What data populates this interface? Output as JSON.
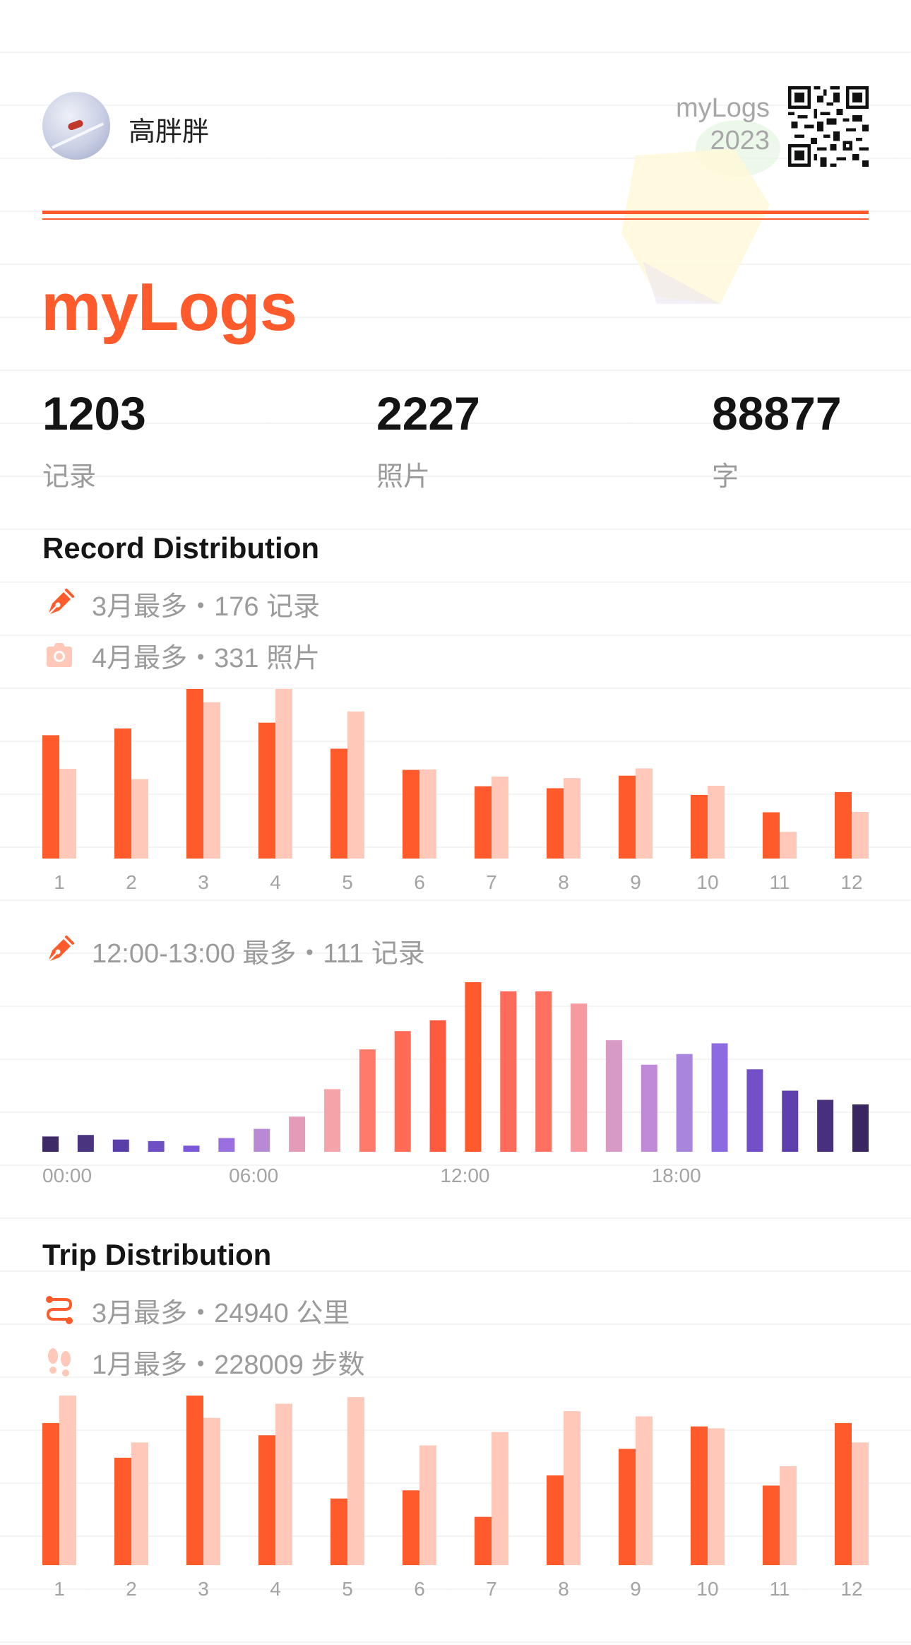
{
  "header": {
    "username": "高胖胖",
    "brand": "myLogs",
    "year": "2023"
  },
  "title": "myLogs",
  "stats": [
    {
      "value": "1203",
      "label": "记录"
    },
    {
      "value": "2227",
      "label": "照片"
    },
    {
      "value": "88877",
      "label": "字"
    }
  ],
  "colors": {
    "accent": "#ff5a2c",
    "accent_light": "#ffc8b8"
  },
  "record_section": {
    "title": "Record Distribution",
    "legend": [
      {
        "icon": "pen-nib-icon",
        "text": "3月最多・176 记录"
      },
      {
        "icon": "camera-icon",
        "text": "4月最多・331 照片"
      }
    ],
    "hour_legend": {
      "icon": "pen-nib-icon",
      "text": "12:00-13:00 最多・111 记录"
    }
  },
  "trip_section": {
    "title": "Trip Distribution",
    "legend": [
      {
        "icon": "route-icon",
        "text": "3月最多・24940 公里"
      },
      {
        "icon": "footprints-icon",
        "text": "1月最多・228009 步数"
      }
    ]
  },
  "chart_data": [
    {
      "type": "bar",
      "categories": [
        "1",
        "2",
        "3",
        "4",
        "5",
        "6",
        "7",
        "8",
        "9",
        "10",
        "11",
        "12"
      ],
      "series": [
        {
          "values": [
            128,
            135,
            176,
            141,
            114,
            92,
            75,
            73,
            86,
            66,
            48,
            69
          ]
        },
        {
          "values": [
            175,
            155,
            305,
            331,
            287,
            174,
            160,
            157,
            176,
            142,
            52,
            91
          ]
        }
      ],
      "ylim": [
        0,
        176
      ],
      "grid": false
    },
    {
      "type": "bar",
      "categories": [
        "00",
        "01",
        "02",
        "03",
        "04",
        "05",
        "06",
        "07",
        "08",
        "09",
        "10",
        "11",
        "12",
        "13",
        "14",
        "15",
        "16",
        "17",
        "18",
        "19",
        "20",
        "21",
        "22",
        "23"
      ],
      "tick_labels": [
        "00:00",
        "06:00",
        "12:00",
        "18:00"
      ],
      "values": [
        10,
        11,
        8,
        7,
        4,
        9,
        15,
        23,
        41,
        67,
        79,
        86,
        111,
        105,
        105,
        97,
        73,
        57,
        64,
        71,
        54,
        40,
        34,
        31
      ],
      "colors": [
        "#3d2a66",
        "#4a3480",
        "#5b3fa8",
        "#6f4fc4",
        "#7a58d8",
        "#9a6fe0",
        "#b88ad6",
        "#e49bb7",
        "#f4a3a8",
        "#ff7a6a",
        "#ff6b55",
        "#ff5a3c",
        "#ff5a2c",
        "#ff6b5a",
        "#ff7060",
        "#f79aa0",
        "#d79ac6",
        "#c08ad8",
        "#a985de",
        "#8c6ae2",
        "#7350c8",
        "#5d3fae",
        "#48307f",
        "#3a2762"
      ],
      "ylim": [
        0,
        111
      ],
      "grid": false
    },
    {
      "type": "bar",
      "categories": [
        "1",
        "2",
        "3",
        "4",
        "5",
        "6",
        "7",
        "8",
        "9",
        "10",
        "11",
        "12"
      ],
      "series": [
        {
          "values": [
            20900,
            15800,
            24940,
            19100,
            9800,
            11000,
            7100,
            13200,
            17100,
            20400,
            11700,
            20900
          ]
        },
        {
          "values": [
            228009,
            165000,
            198000,
            217000,
            226000,
            161000,
            179000,
            207000,
            200000,
            184000,
            133000,
            165000
          ]
        }
      ],
      "ylim": [
        0,
        24940
      ],
      "grid": false
    }
  ]
}
